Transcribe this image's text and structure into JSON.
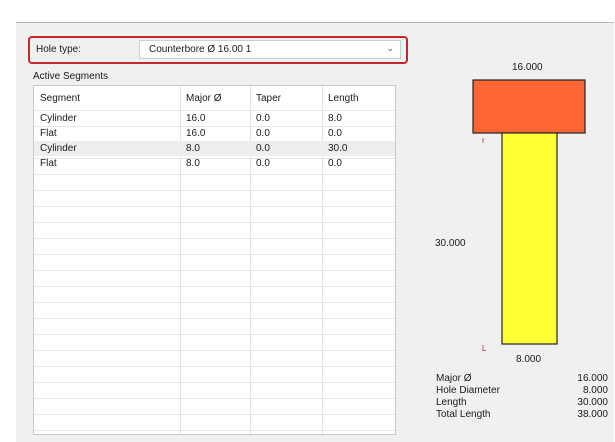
{
  "hole_type": {
    "label": "Hole type:",
    "selected": "Counterbore Ø 16.00 1",
    "dropdown_icon": "chevron-down-icon"
  },
  "segments": {
    "title": "Active Segments",
    "columns": [
      "Segment",
      "Major Ø",
      "Taper",
      "Length"
    ],
    "rows": [
      [
        "Cylinder",
        "16.0",
        "0.0",
        "8.0"
      ],
      [
        "Flat",
        "16.0",
        "0.0",
        "0.0"
      ],
      [
        "Cylinder",
        "8.0",
        "0.0",
        "30.0"
      ],
      [
        "Flat",
        "8.0",
        "0.0",
        "0.0"
      ]
    ],
    "selected_row": 2
  },
  "diagram": {
    "top_dim": "16.000",
    "side_dim": "30.000",
    "bottom_dim": "8.000",
    "marker_top": "r",
    "marker_bottom": "L",
    "counterbore_color": "#ff6633",
    "hole_color": "#ffff33"
  },
  "properties": [
    {
      "label": "Major Ø",
      "value": "16.000"
    },
    {
      "label": "Hole Diameter",
      "value": "8.000"
    },
    {
      "label": "Length",
      "value": "30.000"
    },
    {
      "label": "Total Length",
      "value": "38.000"
    }
  ]
}
